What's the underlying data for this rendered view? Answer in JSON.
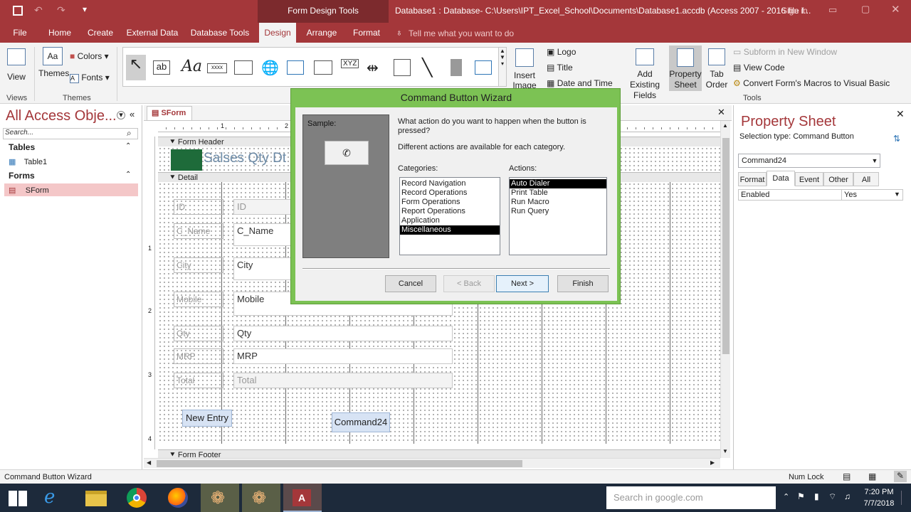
{
  "title_bar": {
    "context_tab": "Form Design Tools",
    "window_title": "Database1 : Database- C:\\Users\\IPT_Excel_School\\Documents\\Database1.accdb (Access 2007 - 2016 file f...",
    "sign_in": "Sign in"
  },
  "ribbon_tabs": [
    "File",
    "Home",
    "Create",
    "External Data",
    "Database Tools",
    "Design",
    "Arrange",
    "Format"
  ],
  "tell_me": "Tell me what you want to do",
  "ribbon": {
    "view": "View",
    "themes": "Themes",
    "colors": "Colors",
    "fonts": "Fonts",
    "group_views": "Views",
    "group_themes": "Themes",
    "insert_image": "Insert Image",
    "logo": "Logo",
    "title": "Title",
    "date_time": "Date and Time",
    "add_fields": "Add Existing Fields",
    "property_sheet": "Property Sheet",
    "tab_order": "Tab Order",
    "subform": "Subform in New Window",
    "view_code": "View Code",
    "convert_macros": "Convert Form's Macros to Visual Basic",
    "group_tools": "Tools"
  },
  "nav": {
    "header": "All Access Obje...",
    "search_placeholder": "Search...",
    "tables_header": "Tables",
    "table1": "Table1",
    "forms_header": "Forms",
    "form1": "SForm"
  },
  "form": {
    "tab_label": "SForm",
    "header_section": "Form Header",
    "header_title": "Salses Qty Dt",
    "detail_section": "Detail",
    "footer_section": "Form Footer",
    "fields": [
      {
        "label": "ID",
        "value": "ID"
      },
      {
        "label": "C_Name",
        "value": "C_Name"
      },
      {
        "label": "City",
        "value": "City"
      },
      {
        "label": "Mobile",
        "value": "Mobile"
      },
      {
        "label": "Qty",
        "value": "Qty"
      },
      {
        "label": "MRP",
        "value": "MRP"
      },
      {
        "label": "Total",
        "value": "Total"
      }
    ],
    "new_entry_button": "New Entry",
    "command_button": "Command24",
    "ruler_top": [
      "1",
      "2"
    ],
    "ruler_left": [
      "1",
      "2",
      "3",
      "4"
    ]
  },
  "property_sheet": {
    "title": "Property Sheet",
    "selection_type": "Selection type:  Command Button",
    "selected_object": "Command24",
    "tabs": [
      "Format",
      "Data",
      "Event",
      "Other",
      "All"
    ],
    "active_tab": "Data",
    "row_name": "Enabled",
    "row_value": "Yes"
  },
  "wizard": {
    "title": "Command Button Wizard",
    "sample_label": "Sample:",
    "question": "What action do you want to happen when the button is pressed?",
    "note": "Different actions are available for each category.",
    "categories_label": "Categories:",
    "categories": [
      "Record Navigation",
      "Record Operations",
      "Form Operations",
      "Report Operations",
      "Application",
      "Miscellaneous"
    ],
    "selected_category": "Miscellaneous",
    "actions_label": "Actions:",
    "actions": [
      "Auto Dialer",
      "Print Table",
      "Run Macro",
      "Run Query"
    ],
    "selected_action": "Auto Dialer",
    "cancel": "Cancel",
    "back": "< Back",
    "next": "Next >",
    "finish": "Finish"
  },
  "status": {
    "left": "Command Button Wizard",
    "num_lock": "Num Lock"
  },
  "taskbar": {
    "search_placeholder": "Search in google.com",
    "time": "7:20 PM",
    "date": "7/7/2018"
  }
}
